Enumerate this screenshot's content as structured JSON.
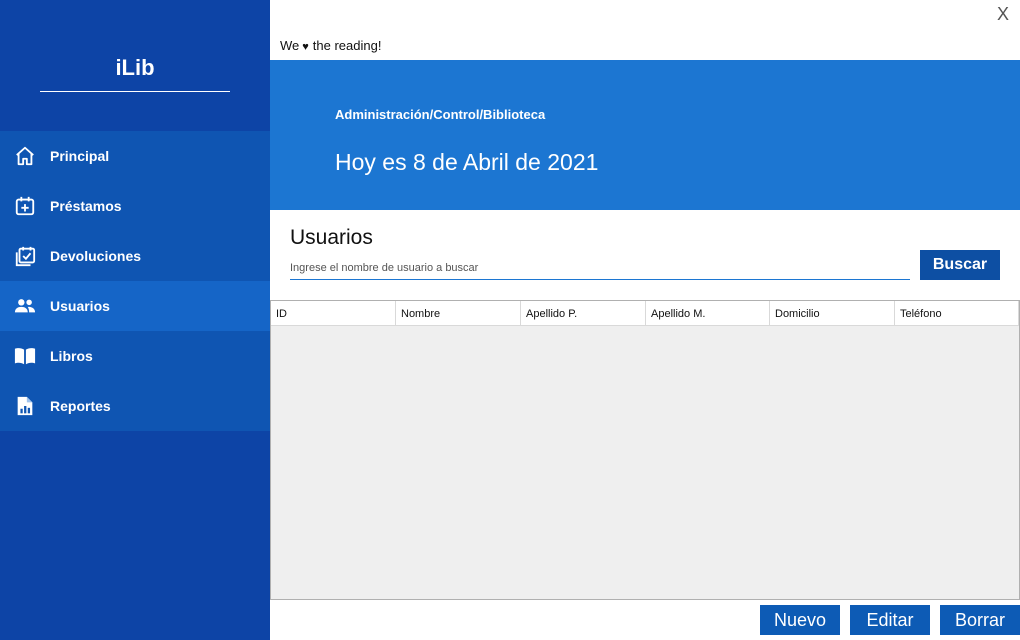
{
  "window": {
    "close_label": "X"
  },
  "tagline": {
    "before": "We",
    "after": "the reading!"
  },
  "sidebar": {
    "logo": "iLib",
    "items": [
      {
        "label": "Principal",
        "icon": "home-icon",
        "active": false
      },
      {
        "label": "Préstamos",
        "icon": "calendar-plus-icon",
        "active": false
      },
      {
        "label": "Devoluciones",
        "icon": "calendar-check-icon",
        "active": false
      },
      {
        "label": "Usuarios",
        "icon": "users-icon",
        "active": true
      },
      {
        "label": "Libros",
        "icon": "book-icon",
        "active": false
      },
      {
        "label": "Reportes",
        "icon": "report-icon",
        "active": false
      }
    ]
  },
  "banner": {
    "breadcrumb": "Administración/Control/Biblioteca",
    "date_text": "Hoy es 8 de Abril de 2021"
  },
  "users": {
    "title": "Usuarios",
    "search_placeholder": "Ingrese el nombre de usuario a buscar",
    "search_button": "Buscar",
    "columns": [
      "ID",
      "Nombre",
      "Apellido P.",
      "Apellido M.",
      "Domicilio",
      "Teléfono"
    ],
    "rows": []
  },
  "actions": {
    "new": "Nuevo",
    "edit": "Editar",
    "delete": "Borrar"
  },
  "colors": {
    "sidebar": "#0d44a6",
    "sidebar_nav": "#0f55b2",
    "sidebar_active": "#1565c7",
    "banner": "#1c76d2",
    "button": "#0d5bb5"
  }
}
